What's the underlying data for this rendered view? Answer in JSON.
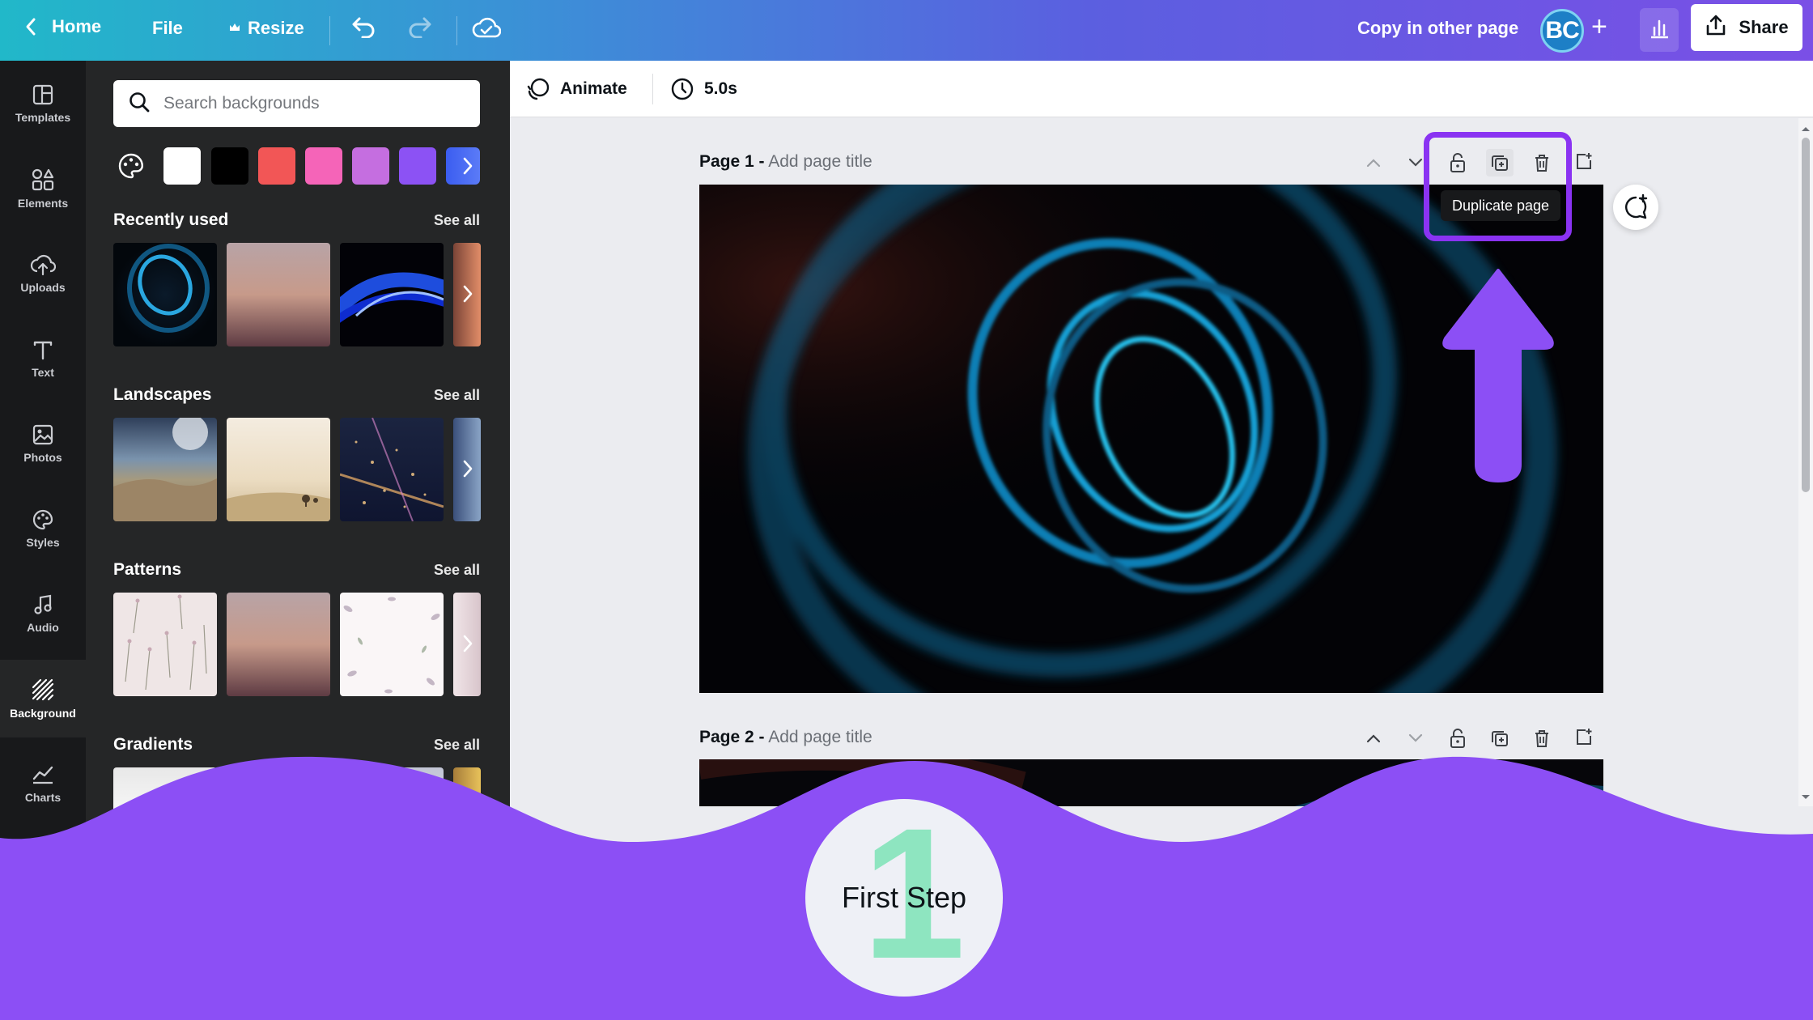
{
  "topbar": {
    "home": "Home",
    "file": "File",
    "resize": "Resize",
    "copy_other_page": "Copy in other page",
    "avatar": "BC",
    "share": "Share"
  },
  "rail": {
    "items": [
      {
        "label": "Templates",
        "icon": "templates-icon"
      },
      {
        "label": "Elements",
        "icon": "elements-icon"
      },
      {
        "label": "Uploads",
        "icon": "uploads-icon"
      },
      {
        "label": "Text",
        "icon": "text-icon"
      },
      {
        "label": "Photos",
        "icon": "photos-icon"
      },
      {
        "label": "Styles",
        "icon": "styles-icon"
      },
      {
        "label": "Audio",
        "icon": "audio-icon"
      },
      {
        "label": "Background",
        "icon": "background-icon",
        "active": true
      },
      {
        "label": "Charts",
        "icon": "charts-icon"
      }
    ]
  },
  "panel": {
    "search_placeholder": "Search backgrounds",
    "swatches": [
      "#ffffff",
      "#000000",
      "#f25656",
      "#f564b8",
      "#c56ee0",
      "#8c52f4"
    ],
    "sections": [
      {
        "title": "Recently used",
        "see_all": "See all"
      },
      {
        "title": "Landscapes",
        "see_all": "See all"
      },
      {
        "title": "Patterns",
        "see_all": "See all"
      },
      {
        "title": "Gradients",
        "see_all": "See all"
      }
    ]
  },
  "editor": {
    "animate": "Animate",
    "duration": "5.0s",
    "pages": [
      {
        "label": "Page 1 -",
        "title_placeholder": "Add page title"
      },
      {
        "label": "Page 2 -",
        "title_placeholder": "Add page title"
      }
    ],
    "tooltip": "Duplicate page"
  },
  "overlay": {
    "step_number": "1",
    "step_text": "First Step",
    "accent": "#8c4ff5"
  }
}
